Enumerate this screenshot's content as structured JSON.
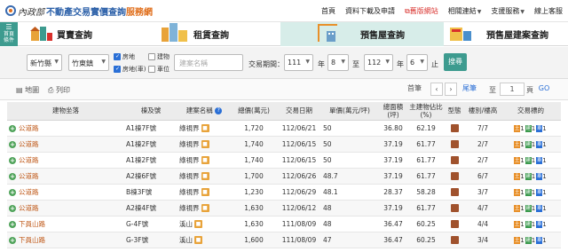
{
  "header": {
    "dept": "內政部",
    "title": "不動產交易實價查詢",
    "title_accent": "服務網",
    "nav": [
      {
        "label": "首頁",
        "kind": "plain"
      },
      {
        "label": "資料下載及申請",
        "kind": "plain"
      },
      {
        "label": "舊版網站",
        "kind": "old"
      },
      {
        "label": "相關連結",
        "kind": "dropdown"
      },
      {
        "label": "支援服務",
        "kind": "dropdown"
      },
      {
        "label": "線上客服",
        "kind": "plain"
      }
    ]
  },
  "sidebar_button": {
    "line1": "首頁",
    "line2": "條件"
  },
  "tabs": [
    {
      "label": "買賣查詢",
      "active": false
    },
    {
      "label": "租賃查詢",
      "active": false
    },
    {
      "label": "預售屋查詢",
      "active": true
    },
    {
      "label": "預售屋建案查詢",
      "active": false
    }
  ],
  "search": {
    "city": "新竹縣",
    "district": "竹東鎮",
    "checkboxes": [
      {
        "label": "房地",
        "checked": true
      },
      {
        "label": "房地(車)",
        "checked": true
      },
      {
        "label": "建物",
        "checked": false
      },
      {
        "label": "車位",
        "checked": false
      }
    ],
    "name_placeholder": "建案名稱",
    "period_label": "交易期間：",
    "from_year": "111",
    "year_unit": "年",
    "from_month": "8",
    "to_label": "至",
    "to_year": "112",
    "to_year_unit": "年",
    "to_month": "6",
    "end_label": "止",
    "search_button": "搜尋"
  },
  "toolbar": {
    "map_view": "地圖",
    "list_view": "列印",
    "first_page": "首筆",
    "prev": "‹",
    "next": "›",
    "last_page": "尾筆",
    "to_label": "至",
    "page_value": "1",
    "page_unit": "頁",
    "go": "GO"
  },
  "table": {
    "headers": [
      "建物坐落",
      "棟及號",
      "建案名稱",
      "總價(萬元)",
      "交易日期",
      "單價(萬元/坪)",
      "總面積(坪)",
      "主建物佔比(%)",
      "型態",
      "樓別/樓高",
      "交易標的"
    ],
    "rows": [
      {
        "addr": "公道路",
        "unit": "A1棟7F號",
        "project": "綠視界",
        "total": "1,720",
        "date": "112/06/21",
        "price": "50",
        "area": "36.80",
        "ratio": "62.19",
        "floor": "7/7",
        "n1": "1",
        "n2": "1",
        "n3": "1"
      },
      {
        "addr": "公道路",
        "unit": "A1棟2F號",
        "project": "綠視界",
        "total": "1,740",
        "date": "112/06/15",
        "price": "50",
        "area": "37.19",
        "ratio": "61.77",
        "floor": "2/7",
        "n1": "1",
        "n2": "1",
        "n3": "1"
      },
      {
        "addr": "公道路",
        "unit": "A1棟2F號",
        "project": "綠視界",
        "total": "1,740",
        "date": "112/06/15",
        "price": "50",
        "area": "37.19",
        "ratio": "61.77",
        "floor": "2/7",
        "n1": "1",
        "n2": "1",
        "n3": "1"
      },
      {
        "addr": "公道路",
        "unit": "A2棟6F號",
        "project": "綠視界",
        "total": "1,700",
        "date": "112/06/26",
        "price": "48.7",
        "area": "37.19",
        "ratio": "61.77",
        "floor": "6/7",
        "n1": "1",
        "n2": "1",
        "n3": "1"
      },
      {
        "addr": "公道路",
        "unit": "B棟3F號",
        "project": "綠視界",
        "total": "1,230",
        "date": "112/06/29",
        "price": "48.1",
        "area": "28.37",
        "ratio": "58.28",
        "floor": "3/7",
        "n1": "1",
        "n2": "1",
        "n3": "1"
      },
      {
        "addr": "公道路",
        "unit": "A2棟4F號",
        "project": "綠視界",
        "total": "1,630",
        "date": "112/06/12",
        "price": "48",
        "area": "37.19",
        "ratio": "61.77",
        "floor": "4/7",
        "n1": "1",
        "n2": "1",
        "n3": "1"
      },
      {
        "addr": "下員山路",
        "unit": "G-4F號",
        "project": "溪山",
        "total": "1,630",
        "date": "111/08/09",
        "price": "48",
        "area": "36.47",
        "ratio": "60.25",
        "floor": "4/4",
        "n1": "1",
        "n2": "1",
        "n3": "1"
      },
      {
        "addr": "下員山路",
        "unit": "G-3F號",
        "project": "溪山",
        "total": "1,600",
        "date": "111/08/09",
        "price": "47",
        "area": "36.47",
        "ratio": "60.25",
        "floor": "3/4",
        "n1": "1",
        "n2": "1",
        "n3": "1"
      }
    ]
  },
  "colors": {
    "teal": "#3d9b8f",
    "brand_blue": "#2a5fa8",
    "accent_orange": "#e0701e",
    "address": "#c05a1a",
    "old_site_red": "#d9302c"
  }
}
